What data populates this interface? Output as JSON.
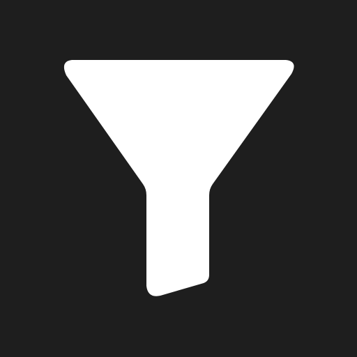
{
  "icon": {
    "name": "filter-icon",
    "background_color": "#1e1e1e",
    "foreground_color": "#ffffff"
  }
}
